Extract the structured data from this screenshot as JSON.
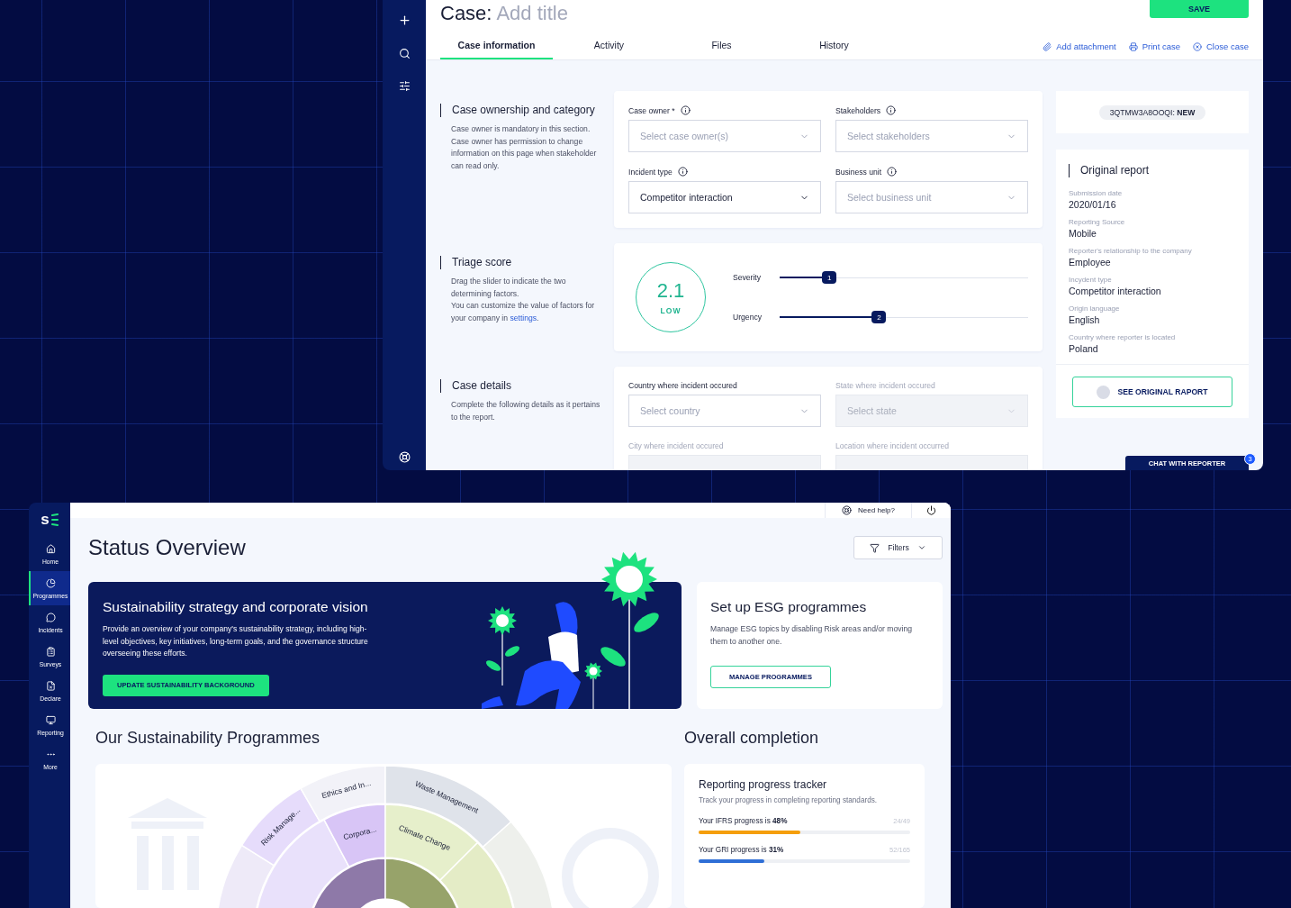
{
  "case_window": {
    "title": "Case:",
    "title_placeholder": "Add title",
    "save_button": "SAVE",
    "tabs": [
      {
        "label": "Case information",
        "selected": true
      },
      {
        "label": "Activity",
        "selected": false
      },
      {
        "label": "Files",
        "selected": false
      },
      {
        "label": "History",
        "selected": false
      }
    ],
    "actions": [
      "Add attachment",
      "Print case",
      "Close case"
    ],
    "sections": [
      {
        "kind": "fields",
        "title": "Case ownership and category",
        "description": [
          "Case owner is mandatory in this section. Case owner has permission to change information on this page when stakeholder can read only."
        ],
        "fields": [
          {
            "label": "Case owner *",
            "info": true,
            "placeholder": "Select case owner(s)",
            "disabled": false
          },
          {
            "label": "Stakeholders",
            "info": true,
            "placeholder": "Select stakeholders",
            "disabled": false
          },
          {
            "label": "Incident type",
            "info": true,
            "value": "Competitor interaction",
            "disabled": false
          },
          {
            "label": "Business unit",
            "info": true,
            "placeholder": "Select business unit",
            "disabled": false
          }
        ]
      },
      {
        "kind": "triage",
        "title": "Triage score",
        "description": [
          "Drag the slider to indicate the two determining factors.",
          "You can customize the value of factors for your company in "
        ],
        "link": "settings",
        "link_suffix": ".",
        "score": {
          "value": "2.1",
          "label": "LOW"
        },
        "sliders": [
          {
            "label": "Severity",
            "value": "1",
            "level": 0.2
          },
          {
            "label": "Urgency",
            "value": "2",
            "level": 0.4
          }
        ]
      },
      {
        "kind": "fields",
        "title": "Case details",
        "description": [
          "Complete the following details as it pertains to the report."
        ],
        "fields": [
          {
            "label": "Country where incident occured",
            "info": false,
            "placeholder": "Select country",
            "disabled": false
          },
          {
            "label": "State where incident occured",
            "info": false,
            "placeholder": "Select state",
            "disabled": true
          },
          {
            "label": "City where incident occured",
            "info": false,
            "disabled": true
          },
          {
            "label": "Location where incident occurred",
            "info": false,
            "disabled": true
          }
        ]
      }
    ],
    "case_id": {
      "code": "3QTMW3A8OOQI:",
      "status": "NEW"
    },
    "report": {
      "title": "Original report",
      "items": [
        {
          "label": "Submission date",
          "value": "2020/01/16"
        },
        {
          "label": "Reporting Source",
          "value": "Mobile"
        },
        {
          "label": "Reporter's relationship to the company",
          "value": "Employee"
        },
        {
          "label": "Incydent type",
          "value": "Competitor interaction"
        },
        {
          "label": "Origin language",
          "value": "English"
        },
        {
          "label": "Country where reporter is located",
          "value": "Poland"
        }
      ],
      "see_button": "SEE ORIGINAL RAPORT",
      "chat_button": "CHAT WITH REPORTER",
      "chat_badge": "3"
    }
  },
  "app_window": {
    "logo": "s",
    "nav": [
      {
        "label": "Home",
        "selected": false
      },
      {
        "label": "Programmes",
        "selected": true
      },
      {
        "label": "Incidents",
        "selected": false
      },
      {
        "label": "Surveys",
        "selected": false
      },
      {
        "label": "Declare",
        "selected": false
      },
      {
        "label": "Reporting",
        "selected": false
      },
      {
        "label": "More",
        "selected": false
      }
    ],
    "help": "Need help?",
    "title": "Status Overview",
    "filters": "Filters",
    "hero": {
      "title": "Sustainability strategy and corporate vision",
      "text": "Provide an overview of your company's sustainability strategy, including high-level objectives, key initiatives, long-term goals, and the governance structure overseeing these efforts.",
      "button": "UPDATE SUSTAINABILITY BACKGROUND"
    },
    "esg": {
      "title": "Set up ESG programmes",
      "text": "Manage ESG topics by disabling Risk areas and/or moving them to another one.",
      "button": "MANAGE PROGRAMMES"
    },
    "programmes": {
      "heading": "Our Sustainability Programmes",
      "middle": [
        "Corpora...",
        "Climate Change"
      ],
      "outer": [
        "Risk Manage...",
        "Ethics and In...",
        "Waste Management"
      ]
    },
    "completion": {
      "heading": "Overall completion",
      "title": "Reporting progress tracker",
      "text": "Track your progress in completing reporting standards.",
      "bars": [
        {
          "label": "Your IFRS progress is **48%**",
          "count": "24/49",
          "level": 0.48,
          "color": "#f59e0b"
        },
        {
          "label": "Your GRI progress is **31%**",
          "count": "52/165",
          "level": 0.31,
          "color": "#2f6fd6"
        }
      ]
    }
  }
}
